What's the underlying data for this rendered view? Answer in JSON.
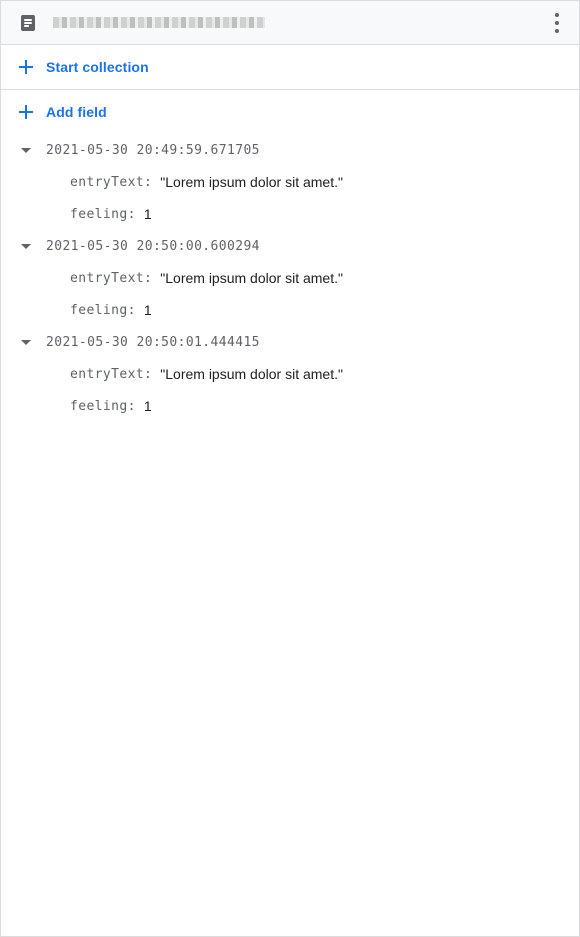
{
  "header": {
    "document_id": "DOC-ID-REDACTED",
    "doc_icon": "document-icon",
    "more_icon": "more-vert-icon"
  },
  "actions": {
    "start_collection": "Start collection",
    "add_field": "Add field"
  },
  "entries": [
    {
      "key": "2021-05-30 20:49:59.671705",
      "fields": [
        {
          "key": "entryText:",
          "value": "\"Lorem ipsum dolor sit amet.\""
        },
        {
          "key": "feeling:",
          "value": "1"
        }
      ]
    },
    {
      "key": "2021-05-30 20:50:00.600294",
      "fields": [
        {
          "key": "entryText:",
          "value": "\"Lorem ipsum dolor sit amet.\""
        },
        {
          "key": "feeling:",
          "value": "1"
        }
      ]
    },
    {
      "key": "2021-05-30 20:50:01.444415",
      "fields": [
        {
          "key": "entryText:",
          "value": "\"Lorem ipsum dolor sit amet.\""
        },
        {
          "key": "feeling:",
          "value": "1"
        }
      ]
    }
  ],
  "colors": {
    "accent": "#1a73e8",
    "muted": "#5f6368",
    "border": "#dadce0",
    "header_bg": "#f8f9fa"
  }
}
